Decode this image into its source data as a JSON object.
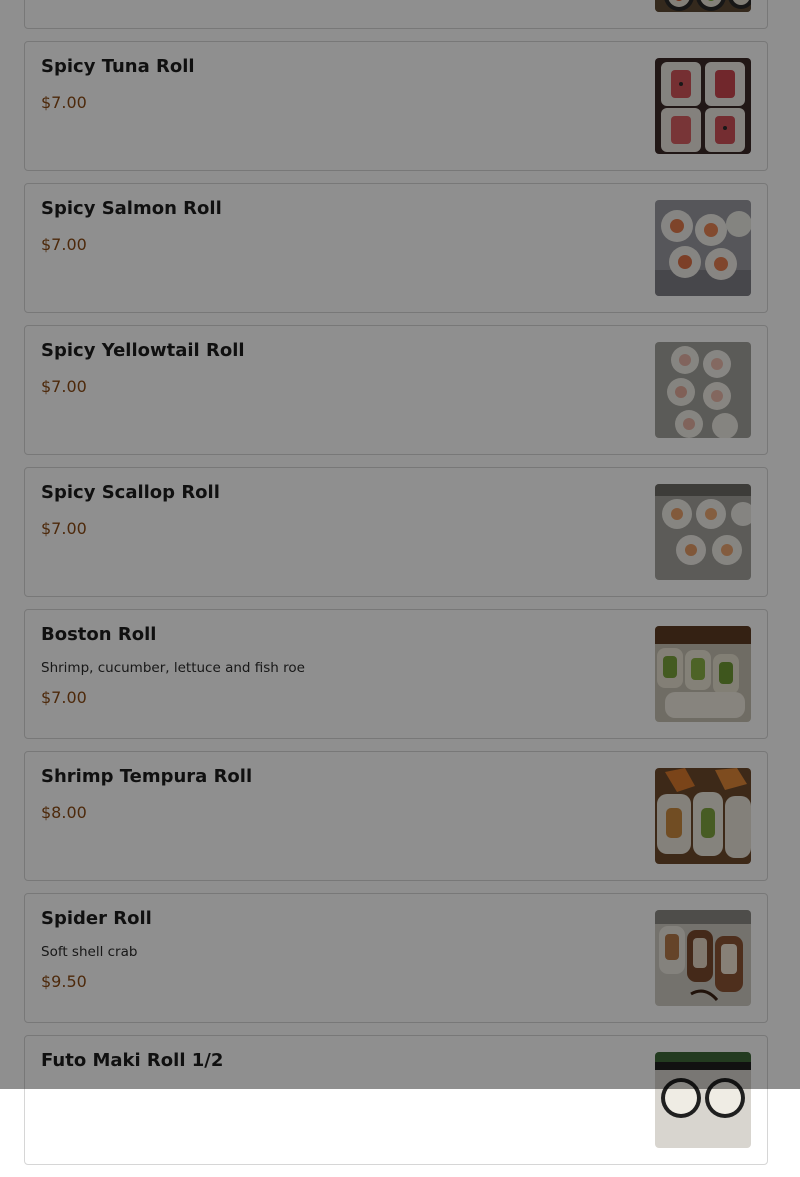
{
  "menu": {
    "items": [
      {
        "name": "",
        "description": "",
        "price": "",
        "photo": "sushi-roll-photo"
      },
      {
        "name": "Spicy Tuna Roll",
        "description": "",
        "price": "$7.00",
        "photo": "spicy-tuna-roll-photo"
      },
      {
        "name": "Spicy Salmon Roll",
        "description": "",
        "price": "$7.00",
        "photo": "spicy-salmon-roll-photo"
      },
      {
        "name": "Spicy Yellowtail Roll",
        "description": "",
        "price": "$7.00",
        "photo": "spicy-yellowtail-roll-photo"
      },
      {
        "name": "Spicy Scallop Roll",
        "description": "",
        "price": "$7.00",
        "photo": "spicy-scallop-roll-photo"
      },
      {
        "name": "Boston Roll",
        "description": "Shrimp, cucumber, lettuce and fish roe",
        "price": "$7.00",
        "photo": "boston-roll-photo"
      },
      {
        "name": "Shrimp Tempura Roll",
        "description": "",
        "price": "$8.00",
        "photo": "shrimp-tempura-roll-photo"
      },
      {
        "name": "Spider Roll",
        "description": "Soft shell crab",
        "price": "$9.50",
        "photo": "spider-roll-photo"
      },
      {
        "name": "Futo Maki Roll 1/2",
        "description": "",
        "price": "",
        "photo": "futo-maki-roll-photo"
      }
    ]
  },
  "colors": {
    "price": "#8a4a14",
    "card_border": "#d6d6d6",
    "overlay": "rgba(0,0,0,0.44)"
  }
}
